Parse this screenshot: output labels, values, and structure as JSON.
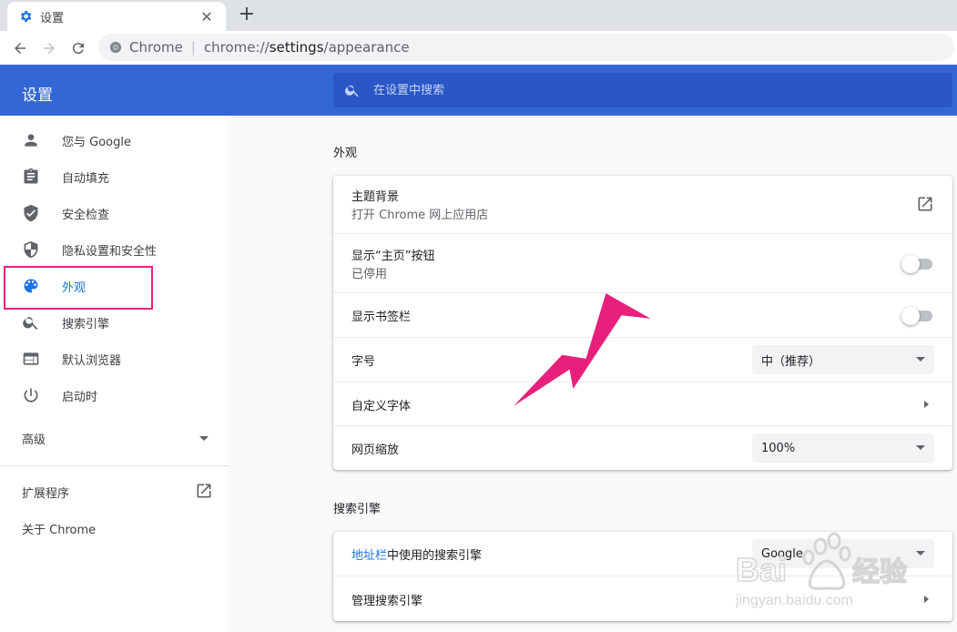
{
  "browser": {
    "tab_title": "设置",
    "omnibox_chip": "Chrome",
    "url_scheme": "chrome://",
    "url_host": "settings",
    "url_path": "/appearance"
  },
  "header": {
    "title": "设置",
    "search_placeholder": "在设置中搜索"
  },
  "sidebar": {
    "items": [
      {
        "label": "您与 Google",
        "icon": "person-icon"
      },
      {
        "label": "自动填充",
        "icon": "clipboard-icon"
      },
      {
        "label": "安全检查",
        "icon": "shield-check-icon"
      },
      {
        "label": "隐私设置和安全性",
        "icon": "shield-half-icon"
      },
      {
        "label": "外观",
        "icon": "palette-icon",
        "active": true
      },
      {
        "label": "搜索引擎",
        "icon": "search-icon"
      },
      {
        "label": "默认浏览器",
        "icon": "browser-window-icon"
      },
      {
        "label": "启动时",
        "icon": "power-icon"
      }
    ],
    "advanced": "高级",
    "extensions": "扩展程序",
    "about": "关于 Chrome"
  },
  "appearance": {
    "section_title": "外观",
    "theme_label": "主题背景",
    "theme_sub": "打开 Chrome 网上应用店",
    "home_label": "显示“主页”按钮",
    "home_sub": "已停用",
    "bookmarks_label": "显示书签栏",
    "font_size_label": "字号",
    "font_size_value": "中（推荐）",
    "custom_fonts_label": "自定义字体",
    "zoom_label": "网页缩放",
    "zoom_value": "100%"
  },
  "search_engine": {
    "section_title": "搜索引擎",
    "address_bar_link": "地址栏",
    "address_bar_rest": "中使用的搜索引擎",
    "engine_value": "Google",
    "manage_label": "管理搜索引擎"
  },
  "colors": {
    "header_bg": "#3367d6",
    "active_nav": "#1a73e8",
    "highlight": "#e8207c"
  }
}
